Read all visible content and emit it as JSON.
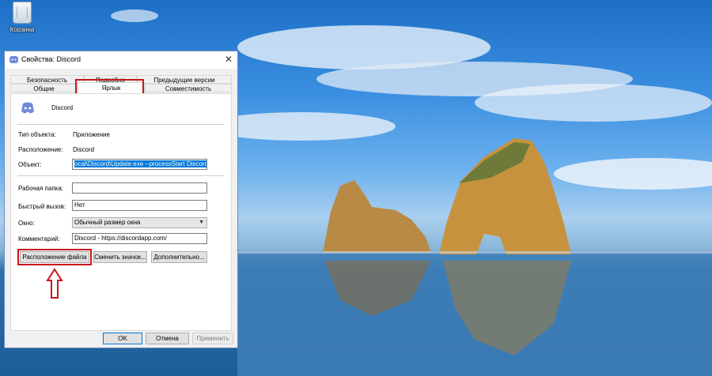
{
  "desktop": {
    "recycle_bin_label": "Корзина"
  },
  "dialog": {
    "title": "Свойства: Discord",
    "tabs_row1": [
      "Безопасность",
      "Подробно",
      "Предыдущие версии"
    ],
    "tabs_row2": [
      "Общие",
      "Ярлык",
      "Совместимость"
    ],
    "active_tab": "Ярлык",
    "app_name": "Discord",
    "type_label": "Тип объекта:",
    "type_value": "Приложение",
    "location_label": "Расположение:",
    "location_value": "Discord",
    "target_label": "Объект:",
    "target_value": "ocal\\Discord\\Update.exe --processStart Discord.exe",
    "workdir_label": "Рабочая папка:",
    "workdir_value": "",
    "hotkey_label": "Быстрый вызов:",
    "hotkey_value": "Нет",
    "window_label": "Окно:",
    "window_value": "Обычный размер окна",
    "comment_label": "Комментарий:",
    "comment_value": "Discord - https://discordapp.com/",
    "open_location_button": "Расположение файла",
    "change_icon_button": "Сменить значок...",
    "advanced_button": "Дополнительно...",
    "ok_button": "OK",
    "cancel_button": "Отмена",
    "apply_button": "Применить"
  },
  "colors": {
    "highlight_red": "#c9161d",
    "selection_blue": "#0078d7"
  }
}
